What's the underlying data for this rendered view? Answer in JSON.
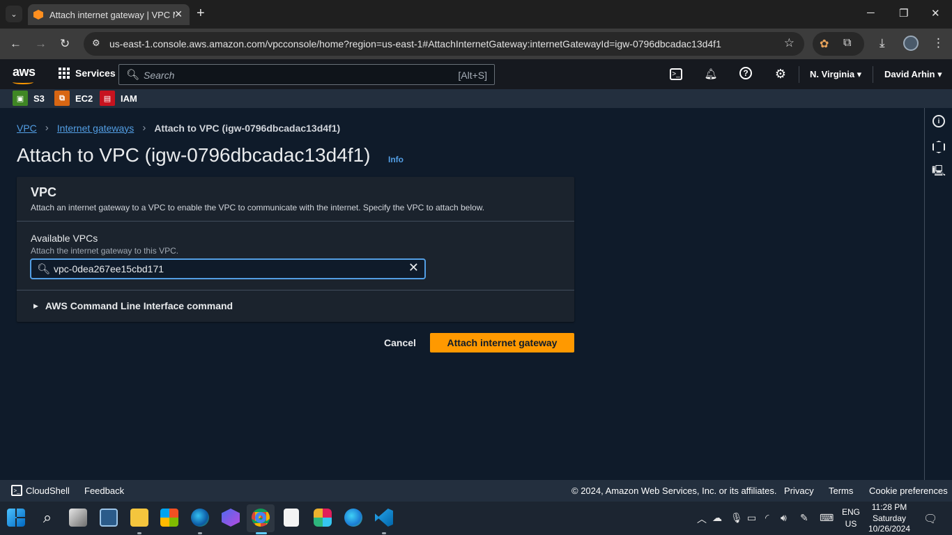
{
  "browser": {
    "tab_title": "Attach internet gateway | VPC M",
    "url": "us-east-1.console.aws.amazon.com/vpcconsole/home?region=us-east-1#AttachInternetGateway:internetGatewayId=igw-0796dbcadac13d4f1"
  },
  "aws_header": {
    "logo": "aws",
    "services_label": "Services",
    "search_placeholder": "Search",
    "search_shortcut": "[Alt+S]",
    "region": "N. Virginia",
    "user": "David Arhin"
  },
  "favorites": [
    {
      "label": "S3",
      "color": "#3f8624",
      "icon": "s3-icon"
    },
    {
      "label": "EC2",
      "color": "#d86613",
      "icon": "ec2-icon"
    },
    {
      "label": "IAM",
      "color": "#c7131f",
      "icon": "iam-icon"
    }
  ],
  "breadcrumb": {
    "items": [
      "VPC",
      "Internet gateways"
    ],
    "current": "Attach to VPC (igw-0796dbcadac13d4f1)"
  },
  "page": {
    "title": "Attach to VPC (igw-0796dbcadac13d4f1)",
    "info_label": "Info"
  },
  "vpc_panel": {
    "title": "VPC",
    "description": "Attach an internet gateway to a VPC to enable the VPC to communicate with the internet. Specify the VPC to attach below.",
    "field_label": "Available VPCs",
    "field_description": "Attach the internet gateway to this VPC.",
    "field_value": "vpc-0dea267ee15cbd171",
    "cli_label": "AWS Command Line Interface command"
  },
  "actions": {
    "cancel": "Cancel",
    "attach": "Attach internet gateway"
  },
  "footer": {
    "cloudshell": "CloudShell",
    "feedback": "Feedback",
    "copyright": "© 2024, Amazon Web Services, Inc. or its affiliates.",
    "privacy": "Privacy",
    "terms": "Terms",
    "cookies": "Cookie preferences"
  },
  "taskbar": {
    "lang_line1": "ENG",
    "lang_line2": "US",
    "time": "11:28 PM",
    "day": "Saturday",
    "date": "10/26/2024"
  },
  "colors": {
    "accent_orange": "#ff9900",
    "link_blue": "#539fe5"
  }
}
